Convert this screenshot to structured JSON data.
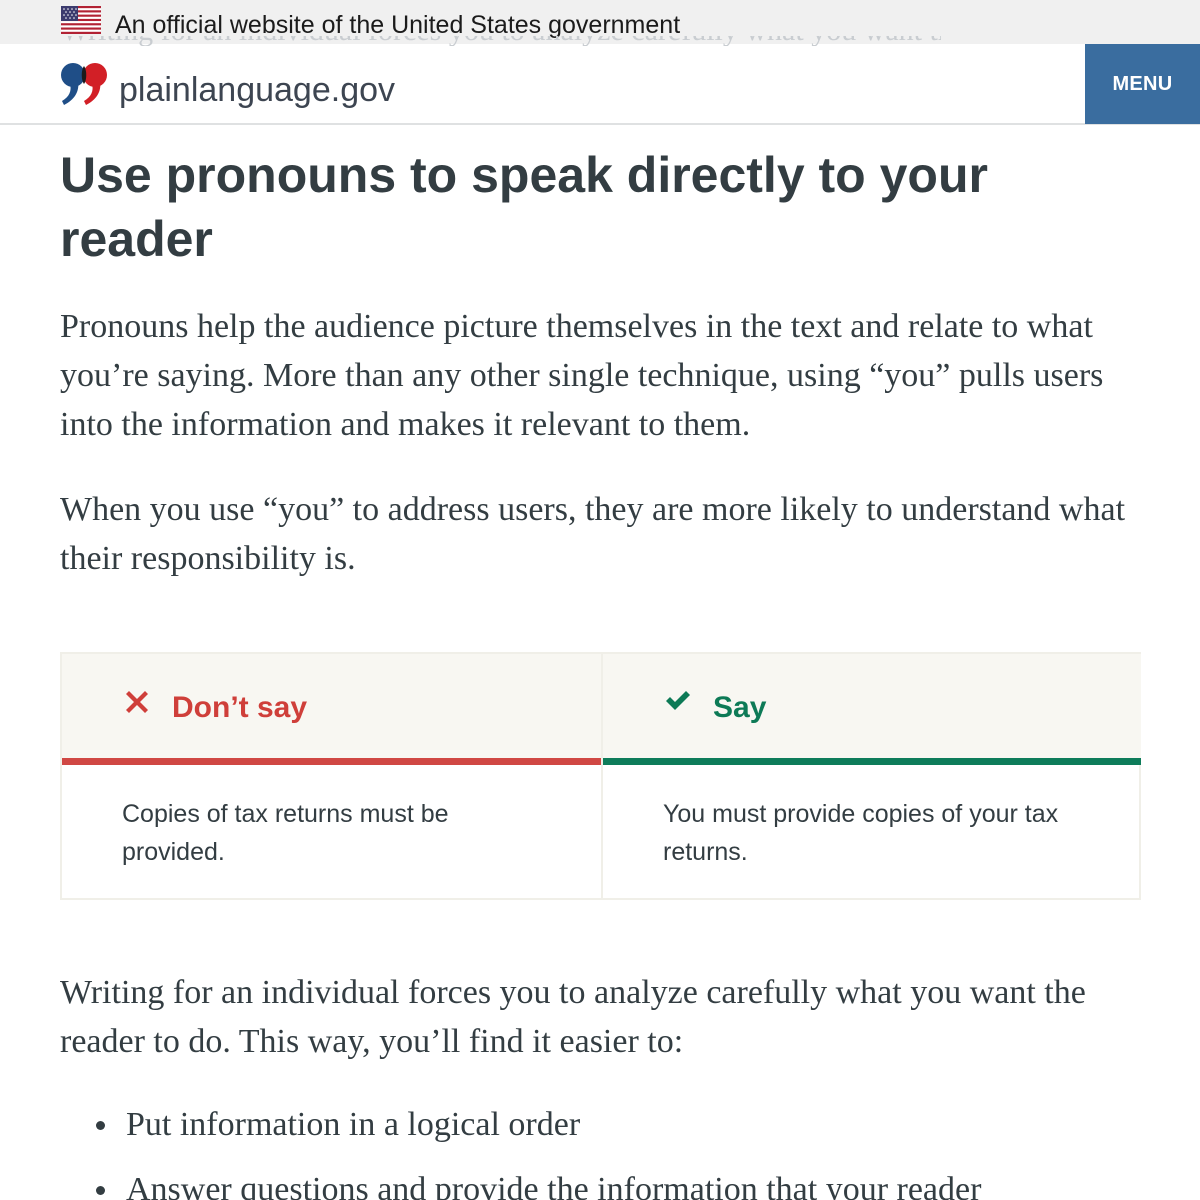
{
  "gov_banner": {
    "text": "An official website of the United States government",
    "icon": "us-flag-icon"
  },
  "header": {
    "site_name": "plainlanguage.gov",
    "logo_icon": "quote-marks-logo",
    "menu_label": "MENU"
  },
  "article": {
    "title": "Use pronouns to speak directly to your reader",
    "paragraphs": [
      "Pronouns help the audience picture themselves in the text and relate to what you’re saying. More than any other single technique, using “you” pulls users into the information and makes it relevant to them.",
      "When you use “you” to address users, they are more likely to understand what their responsibility is.",
      "Writing for an individual forces you to analyze carefully what you want the reader to do. This way, you’ll find it easier to:"
    ],
    "comparison": {
      "dont": {
        "label": "Don’t say",
        "icon": "x-mark-icon",
        "text": "Copies of tax returns must be provided.",
        "color": "#cf3f3a"
      },
      "do": {
        "label": "Say",
        "icon": "check-mark-icon",
        "text": "You must provide copies of your tax returns.",
        "color": "#0d7a56"
      }
    },
    "list": [
      "Put information in a logical order",
      "Answer questions and provide the information that your reader"
    ]
  },
  "colors": {
    "menu_background": "#3a6d9f",
    "text": "#333d42",
    "banner_background": "#f0f0f0"
  }
}
